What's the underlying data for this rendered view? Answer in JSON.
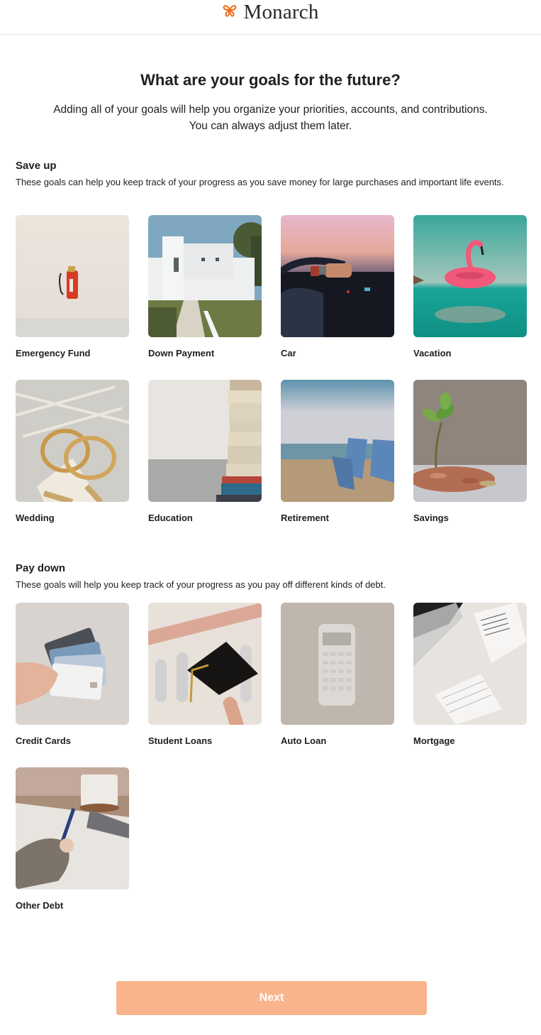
{
  "header": {
    "logo_text": "Monarch",
    "logo_icon": "butterfly-icon",
    "brand_color": "#f26d21"
  },
  "page": {
    "title": "What are your goals for the future?",
    "subtitle_line1": "Adding all of your goals will help you organize your priorities, accounts, and contributions.",
    "subtitle_line2": "You can always adjust them later."
  },
  "sections": {
    "save_up": {
      "title": "Save up",
      "description": "These goals can help you keep track of your progress as you save money for large purchases and important life events.",
      "goals": [
        {
          "label": "Emergency Fund",
          "image": "fire-extinguisher-photo"
        },
        {
          "label": "Down Payment",
          "image": "white-house-photo"
        },
        {
          "label": "Car",
          "image": "steering-wheel-photo"
        },
        {
          "label": "Vacation",
          "image": "flamingo-float-photo"
        },
        {
          "label": "Wedding",
          "image": "wedding-rings-photo"
        },
        {
          "label": "Education",
          "image": "book-stack-photo"
        },
        {
          "label": "Retirement",
          "image": "beach-chairs-photo"
        },
        {
          "label": "Savings",
          "image": "plant-coins-photo"
        }
      ]
    },
    "pay_down": {
      "title": "Pay down",
      "description": "These goals will help you keep track of your progress as you pay off different kinds of debt.",
      "goals": [
        {
          "label": "Credit Cards",
          "image": "credit-cards-photo"
        },
        {
          "label": "Student Loans",
          "image": "graduation-cap-photo"
        },
        {
          "label": "Auto Loan",
          "image": "calculator-photo"
        },
        {
          "label": "Mortgage",
          "image": "paperwork-photo"
        },
        {
          "label": "Other Debt",
          "image": "writing-hand-photo"
        }
      ]
    }
  },
  "footer": {
    "next_label": "Next",
    "next_color": "#f9b48b"
  }
}
